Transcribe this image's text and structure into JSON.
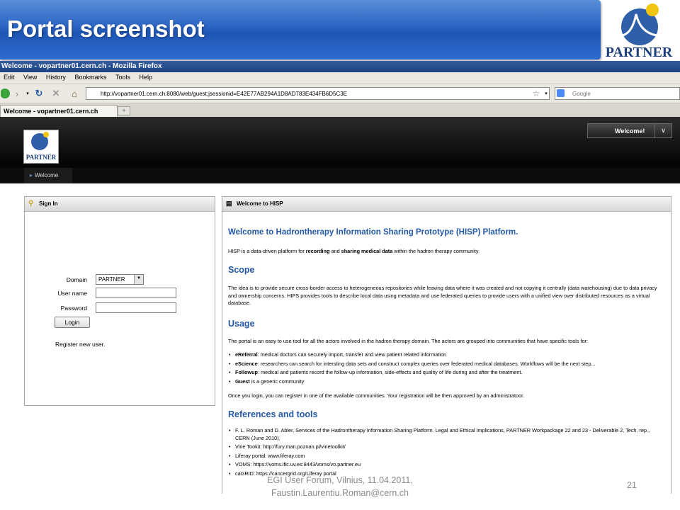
{
  "slide": {
    "title": "Portal screenshot",
    "logo_text": "PARTNER",
    "footer_line1": "EGI User Forum, Vilnius, 11.04.2011,",
    "footer_line2": "Faustin.Laurentiu.Roman@cern.ch",
    "page_number": "21"
  },
  "browser": {
    "window_title": "Welcome - vopartner01.cern.ch - Mozilla Firefox",
    "menu": [
      "Edit",
      "View",
      "History",
      "Bookmarks",
      "Tools",
      "Help"
    ],
    "url": "http://vopartner01.cern.ch:8080/web/guest;jsessionid=E42E77AB294A1D8AD783E434FB6D5C3E",
    "search_placeholder": "Google",
    "tab_label": "Welcome - vopartner01.cern.ch",
    "tab_new": "+"
  },
  "portal": {
    "logo_text": "PARTNER",
    "welcome_button": "Welcome!",
    "nav_item": "Welcome"
  },
  "signin": {
    "header": "Sign In",
    "domain_label": "Domain",
    "domain_value": "PARTNER",
    "username_label": "User name",
    "password_label": "Password",
    "login_button": "Login",
    "register_link": "Register new user."
  },
  "welcome": {
    "header": "Welcome to HISP",
    "heading": "Welcome to Hadrontherapy Information Sharing Prototype (HISP) Platform.",
    "intro_pre": "HISP is a data-driven platform for ",
    "intro_b1": "recording",
    "intro_mid": " and ",
    "intro_b2": "sharing medical data",
    "intro_post": " within the hadron therapy community.",
    "scope_title": "Scope",
    "scope_text": "The idea is to provide secure cross-border access to heterogeneous repositories while leaving data where it was created and not copying it centrally (data warehousing) due to data privacy and ownership concerns. HIPS provides tools to describe local data using metadata and use federated queries to provide users with a unified view over distributed resources as a virtual database.",
    "usage_title": "Usage",
    "usage_text": "The portal is an easy to use tool for all the actors involved in the hadron therapy domain. The actors are grouped into communities that have specific tools for:",
    "usage_items": [
      {
        "term": "eReferral",
        "desc": ": medical doctors can securely import, transfer and view patient related information"
      },
      {
        "term": "eScience",
        "desc": ": researchers can search for intersting data sets and construct complex queries over federated medical databases. Workflows will be the next step..."
      },
      {
        "term": "Followup",
        "desc": ": medical and patients record the follow-up information, side-effects and quality of life during and after the treatment."
      },
      {
        "term": "Guest",
        "desc": " is a generic community"
      }
    ],
    "usage_after": "Once you login, you can register in one of the available communities. Your registration will be then approved by an administratoor.",
    "refs_title": "References and tools",
    "refs_items": [
      "F. L. Roman and D. Abler, Services of the Hadrontherapy Information Sharing Platform. Legal and Ethical implications, PARTNER Workpackage 22 and 23 - Deliverable 2, Tech. rep., CERN (June 2010).",
      "Vine Tookit: http://fury.man.poznan.pl/vinetoolkit/",
      "Liferay portal: www.liferay.com",
      "VOMS: https://voms.ific.uv.es:8443/voms/vo.partner.eu",
      "caGRID: https://cancergrid.org/Liferay portal"
    ]
  },
  "colors": {
    "banner_blue": "#2a64c4",
    "heading_blue": "#2459a6",
    "portal_header": "#050505"
  }
}
